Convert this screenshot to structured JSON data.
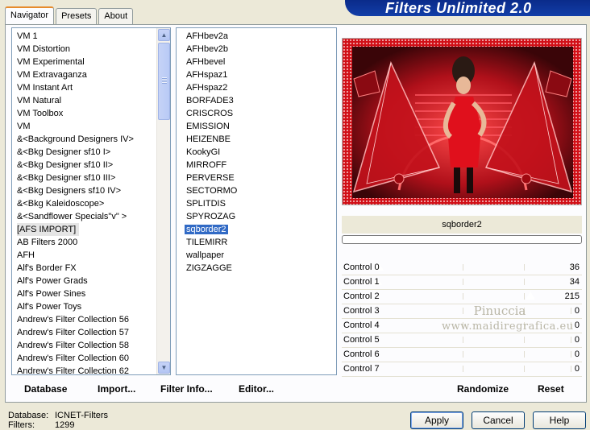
{
  "banner": {
    "title": "Filters Unlimited 2.0"
  },
  "tabs": [
    {
      "label": "Navigator",
      "active": true
    },
    {
      "label": "Presets",
      "active": false
    },
    {
      "label": "About",
      "active": false
    }
  ],
  "categories": [
    "VM 1",
    "VM Distortion",
    "VM Experimental",
    "VM Extravaganza",
    "VM Instant Art",
    "VM Natural",
    "VM Toolbox",
    "VM",
    "&<Background Designers IV>",
    "&<Bkg Designer sf10 I>",
    "&<Bkg Designer sf10 II>",
    "&<Bkg Designer sf10 III>",
    "&<Bkg Designers sf10 IV>",
    "&<Bkg Kaleidoscope>",
    "&<Sandflower Specials\"v\" >",
    "[AFS IMPORT]",
    "AB Filters 2000",
    "AFH",
    "Alf's Border FX",
    "Alf's Power Grads",
    "Alf's Power Sines",
    "Alf's Power Toys",
    "Andrew's Filter Collection 56",
    "Andrew's Filter Collection 57",
    "Andrew's Filter Collection 58",
    "Andrew's Filter Collection 60",
    "Andrew's Filter Collection 62"
  ],
  "selected_category": "[AFS IMPORT]",
  "filters": [
    "AFHbev2a",
    "AFHbev2b",
    "AFHbevel",
    "AFHspaz1",
    "AFHspaz2",
    "BORFADE3",
    "CRISCROS",
    "EMISSION",
    "HEIZENBE",
    "KookyGI",
    "MIRROFF",
    "PERVERSE",
    "SECTORMO",
    "SPLITDIS",
    "SPYROZAG",
    "sqborder2",
    "TILEMIRR",
    "wallpaper",
    "ZIGZAGGE"
  ],
  "selected_filter": "sqborder2",
  "preview": {
    "filter_name": "sqborder2",
    "progress": 0
  },
  "controls": [
    {
      "label": "Control 0",
      "value": "36"
    },
    {
      "label": "Control 1",
      "value": "34"
    },
    {
      "label": "Control 2",
      "value": "215"
    },
    {
      "label": "Control 3",
      "value": "0"
    },
    {
      "label": "Control 4",
      "value": "0"
    },
    {
      "label": "Control 5",
      "value": "0"
    },
    {
      "label": "Control 6",
      "value": "0"
    },
    {
      "label": "Control 7",
      "value": "0"
    }
  ],
  "watermark": {
    "line1": "Pinuccia",
    "line2": "www.maidiregrafica.eu"
  },
  "actions": {
    "database": "Database",
    "import": "Import...",
    "filter_info": "Filter Info...",
    "editor": "Editor...",
    "randomize": "Randomize",
    "reset": "Reset"
  },
  "status": {
    "database_label": "Database:",
    "database_value": "ICNET-Filters",
    "filters_label": "Filters:",
    "filters_value": "1299"
  },
  "dialog": {
    "apply": "Apply",
    "cancel": "Cancel",
    "help": "Help"
  },
  "colors": {
    "accent_blue": "#316ac5",
    "banner": "#0a2b8a",
    "preview_red": "#d20f1a"
  }
}
